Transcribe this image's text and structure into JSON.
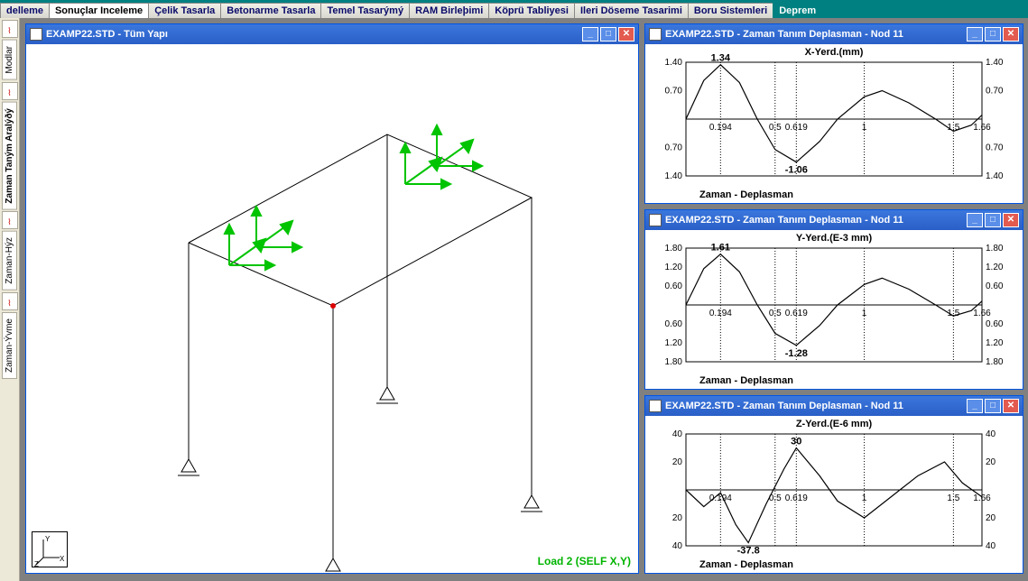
{
  "tabs": {
    "items": [
      "delleme",
      "Sonuçlar Inceleme",
      "Çelik Tasarla",
      "Betonarme Tasarla",
      "Temel Tasarýmý",
      "RAM Birleþimi",
      "Köprü Tabliyesi",
      "Ileri Döseme Tasarimi",
      "Boru Sistemleri",
      "Deprem"
    ],
    "active_index": 1
  },
  "sidebar": {
    "items": [
      "Modlar",
      "Zaman Taným Aralýðý",
      "Zaman-Hýz",
      "Zaman-Ývme"
    ]
  },
  "main_window": {
    "title": "EXAMP22.STD - Tüm Yapı",
    "load_label": "Load 2 (SELF X,Y)",
    "axis_labels": {
      "x": "X",
      "y": "Y",
      "z": "Z"
    }
  },
  "charts": [
    {
      "window_title": "EXAMP22.STD - Zaman Tanım Deplasman - Nod 11",
      "plot_title": "X-Yerd.(mm)",
      "x_axis_label": "Zaman - Deplasman",
      "peak_pos_label": "1.34",
      "peak_neg_label": "-1.06",
      "x_ticks": [
        "0.194",
        "0.5",
        "0.619",
        "1",
        "1.5",
        "1.66"
      ],
      "y_ticks_left": [
        "1.40",
        "0.70",
        "0.70",
        "1.40"
      ],
      "y_ticks_right": [
        "1.40",
        "0.70",
        "0.70",
        "1.40"
      ]
    },
    {
      "window_title": "EXAMP22.STD - Zaman Tanım Deplasman - Nod 11",
      "plot_title": "Y-Yerd.(E-3 mm)",
      "x_axis_label": "Zaman - Deplasman",
      "peak_pos_label": "1.61",
      "peak_neg_label": "-1.28",
      "x_ticks": [
        "0.194",
        "0.5",
        "0.619",
        "1",
        "1.5",
        "1.66"
      ],
      "y_ticks_left": [
        "1.80",
        "1.20",
        "0.60",
        "0.60",
        "1.20",
        "1.80"
      ],
      "y_ticks_right": [
        "1.80",
        "1.20",
        "0.60",
        "0.60",
        "1.20",
        "1.80"
      ]
    },
    {
      "window_title": "EXAMP22.STD - Zaman Tanım Deplasman - Nod 11",
      "plot_title": "Z-Yerd.(E-6 mm)",
      "x_axis_label": "Zaman - Deplasman",
      "peak_pos_label": "30",
      "peak_neg_label": "-37.8",
      "x_ticks": [
        "0.194",
        "0.5",
        "0.619",
        "1",
        "1.5",
        "1.66"
      ],
      "y_ticks_left": [
        "40",
        "20",
        "20",
        "40"
      ],
      "y_ticks_right": [
        "40",
        "20",
        "20",
        "40"
      ]
    }
  ],
  "chart_data": [
    {
      "type": "line",
      "title": "X-Yerd.(mm)",
      "xlabel": "Zaman - Deplasman",
      "ylabel": "",
      "xlim": [
        0,
        1.66
      ],
      "ylim": [
        -1.4,
        1.4
      ],
      "annotations": [
        {
          "x": 0.194,
          "y": 1.34,
          "text": "1.34"
        },
        {
          "x": 0.619,
          "y": -1.06,
          "text": "-1.06"
        }
      ],
      "series": [
        {
          "name": "X-Yerd",
          "x": [
            0,
            0.1,
            0.194,
            0.3,
            0.4,
            0.5,
            0.619,
            0.75,
            0.85,
            1.0,
            1.1,
            1.25,
            1.4,
            1.5,
            1.6,
            1.66
          ],
          "values": [
            0,
            0.95,
            1.34,
            0.9,
            0.0,
            -0.75,
            -1.06,
            -0.55,
            0.0,
            0.55,
            0.7,
            0.4,
            0.0,
            -0.3,
            -0.15,
            0.1
          ]
        }
      ]
    },
    {
      "type": "line",
      "title": "Y-Yerd.(E-3 mm)",
      "xlabel": "Zaman - Deplasman",
      "ylabel": "",
      "xlim": [
        0,
        1.66
      ],
      "ylim": [
        -1.8,
        1.8
      ],
      "annotations": [
        {
          "x": 0.194,
          "y": 1.61,
          "text": "1.61"
        },
        {
          "x": 0.619,
          "y": -1.28,
          "text": "-1.28"
        }
      ],
      "series": [
        {
          "name": "Y-Yerd",
          "x": [
            0,
            0.1,
            0.194,
            0.3,
            0.4,
            0.5,
            0.619,
            0.75,
            0.85,
            1.0,
            1.1,
            1.25,
            1.4,
            1.5,
            1.6,
            1.66
          ],
          "values": [
            0,
            1.15,
            1.61,
            1.05,
            0.0,
            -0.9,
            -1.28,
            -0.65,
            0.0,
            0.65,
            0.85,
            0.5,
            0.0,
            -0.35,
            -0.18,
            0.12
          ]
        }
      ]
    },
    {
      "type": "line",
      "title": "Z-Yerd.(E-6 mm)",
      "xlabel": "Zaman - Deplasman",
      "ylabel": "",
      "xlim": [
        0,
        1.66
      ],
      "ylim": [
        -40,
        40
      ],
      "annotations": [
        {
          "x": 0.619,
          "y": 30,
          "text": "30"
        },
        {
          "x": 0.35,
          "y": -37.8,
          "text": "-37.8"
        }
      ],
      "series": [
        {
          "name": "Z-Yerd",
          "x": [
            0,
            0.1,
            0.194,
            0.28,
            0.35,
            0.45,
            0.55,
            0.619,
            0.75,
            0.85,
            1.0,
            1.15,
            1.3,
            1.45,
            1.55,
            1.66
          ],
          "values": [
            0,
            -12,
            -2,
            -25,
            -37.8,
            -10,
            15,
            30,
            10,
            -8,
            -20,
            -5,
            10,
            20,
            5,
            -5
          ]
        }
      ]
    }
  ]
}
